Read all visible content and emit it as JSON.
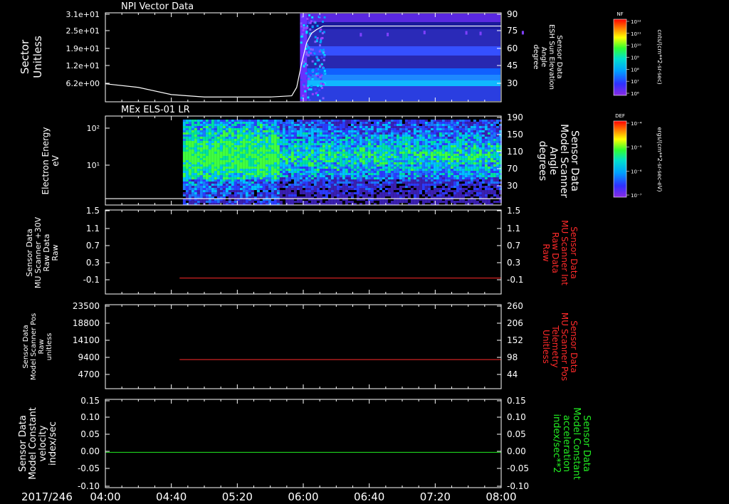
{
  "date_label": "2017/246",
  "time_ticks": [
    "04:00",
    "04:40",
    "05:20",
    "06:00",
    "06:40",
    "07:20",
    "08:00"
  ],
  "colors": {
    "white": "#ffffff",
    "red": "#ff2a2a",
    "green": "#22ee22",
    "frame": "#ffffff",
    "background": "#000000"
  },
  "colorbars": [
    {
      "title": "NF",
      "unit_label": "cnts/(cm**2-sr-sec)",
      "ticks": [
        "10¹²",
        "10¹¹",
        "10¹⁰",
        "10⁹",
        "10⁸",
        "10⁷",
        "10⁶"
      ]
    },
    {
      "title": "DEF",
      "unit_label": "ergs/(cm**2-sr-sec-eV)",
      "ticks": [
        "10⁻⁴",
        "10⁻⁵",
        "10⁻⁶",
        "10⁻⁷"
      ]
    }
  ],
  "chart_data": [
    {
      "type": "heatmap",
      "title": "NPI Vector Data",
      "ylabel": [
        "Sector",
        "Unitless"
      ],
      "left_ticks": [
        "3.1e+01",
        "2.5e+01",
        "1.9e+01",
        "1.2e+01",
        "6.2e+00"
      ],
      "right_ticks": [
        "90",
        "75",
        "60",
        "45",
        "30"
      ],
      "right_ylabel": [
        "Sensor Data",
        "ESH Sun Elevation",
        "Angle",
        "degree"
      ],
      "right_ylim": [
        16,
        90
      ],
      "data_start_time": "05:58",
      "overlay": {
        "name": "ESH Sun Elevation Angle",
        "x": [
          "04:00",
          "04:20",
          "04:40",
          "05:00",
          "05:20",
          "05:40",
          "05:53",
          "05:56",
          "05:59",
          "06:02",
          "06:05",
          "06:08",
          "06:12",
          "06:20",
          "06:40",
          "07:20",
          "08:00"
        ],
        "y": [
          31,
          28,
          22,
          20,
          20,
          20,
          21,
          28,
          48,
          65,
          73,
          76,
          79,
          79,
          79,
          79,
          79
        ]
      }
    },
    {
      "type": "heatmap",
      "title": "MEx ELS-01 LR",
      "ylabel": [
        "Electron Energy",
        "eV"
      ],
      "left_ticks": [
        "10²",
        "10¹"
      ],
      "right_ticks": [
        "190",
        "150",
        "110",
        "70",
        "30"
      ],
      "right_ylabel": [
        "Sensor Data",
        "Model Scanner",
        "Angle",
        "degrees"
      ],
      "right_ylim": [
        0,
        190
      ],
      "data_start_time": "04:47",
      "overlay": {
        "name": "Model Scanner Angle",
        "x": [
          "04:00",
          "08:00"
        ],
        "y": [
          6,
          6
        ]
      }
    },
    {
      "type": "line",
      "left_ticks": [
        "1.5",
        "1.1",
        "0.7",
        "0.3",
        "-0.1"
      ],
      "ylim": [
        -0.3,
        1.5
      ],
      "ylabel": [
        "Sensor Data",
        "MU Scanner +30V",
        "Raw Data",
        "Raw"
      ],
      "right_ticks": [
        "1.5",
        "1.1",
        "0.7",
        "0.3",
        "-0.1"
      ],
      "right_ylabel": [
        "Sensor Data",
        "MU Scanner Int",
        "Raw Data",
        "Raw"
      ],
      "series": [
        {
          "name": "MU Scanner Int Raw Data",
          "x": [
            "04:45",
            "08:00"
          ],
          "y": [
            0,
            0
          ]
        }
      ]
    },
    {
      "type": "line",
      "left_ticks": [
        "23500",
        "18800",
        "14100",
        "9400",
        "4700"
      ],
      "ylim": [
        0,
        23500
      ],
      "ylabel": [
        "Sensor Data",
        "Model Scanner Pos",
        "Raw",
        "unitless"
      ],
      "right_ticks": [
        "260",
        "206",
        "152",
        "98",
        "44"
      ],
      "right_ylim": [
        0,
        260
      ],
      "right_ylabel": [
        "Sensor Data",
        "MU Scanner Pos",
        "Telemetry",
        "Unitless"
      ],
      "series": [
        {
          "name": "MU Scanner Pos Telemetry",
          "x": [
            "04:45",
            "08:00"
          ],
          "y": [
            90,
            90
          ]
        }
      ]
    },
    {
      "type": "line",
      "left_ticks": [
        "0.15",
        "0.10",
        "0.05",
        "0.00",
        "-0.05",
        "-0.10"
      ],
      "ylim": [
        -0.1,
        0.15
      ],
      "ylabel": [
        "Sensor Data",
        "Model Constant",
        "velocity",
        "index/sec"
      ],
      "right_ticks": [
        "0.15",
        "0.10",
        "0.05",
        "0.00",
        "-0.05",
        "-0.10"
      ],
      "right_ylabel": [
        "Sensor Data",
        "Model Constant",
        "acceleration",
        "index/sec**2"
      ],
      "series": [
        {
          "name": "Model Constant acceleration",
          "x": [
            "04:00",
            "08:00"
          ],
          "y": [
            0,
            0
          ]
        }
      ]
    }
  ]
}
